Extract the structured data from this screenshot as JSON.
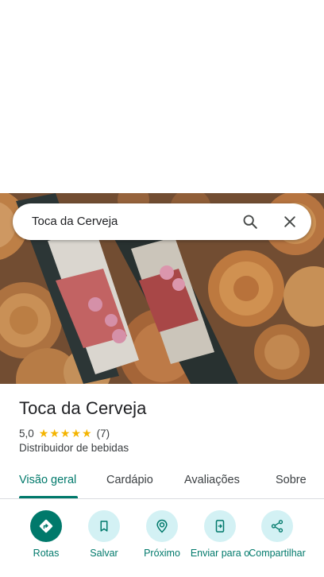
{
  "search": {
    "query": "Toca da Cerveja",
    "search_icon": "search-icon",
    "close_icon": "close-icon"
  },
  "place": {
    "name": "Toca da Cerveja",
    "rating": "5,0",
    "stars": 5,
    "review_count": "(7)",
    "category": "Distribuidor de bebidas"
  },
  "tabs": [
    {
      "label": "Visão geral",
      "active": true
    },
    {
      "label": "Cardápio",
      "active": false
    },
    {
      "label": "Avaliações",
      "active": false
    },
    {
      "label": "Sobre",
      "active": false
    }
  ],
  "actions": [
    {
      "label": "Rotas",
      "icon": "directions-icon"
    },
    {
      "label": "Salvar",
      "icon": "bookmark-icon"
    },
    {
      "label": "Próximo",
      "icon": "nearby-icon"
    },
    {
      "label": "Enviar para o",
      "icon": "send-to-phone-icon"
    },
    {
      "label": "Compartilhar",
      "icon": "share-icon"
    }
  ],
  "colors": {
    "accent": "#00796b",
    "action_bg": "#d3f1f4",
    "star": "#f4b400"
  }
}
